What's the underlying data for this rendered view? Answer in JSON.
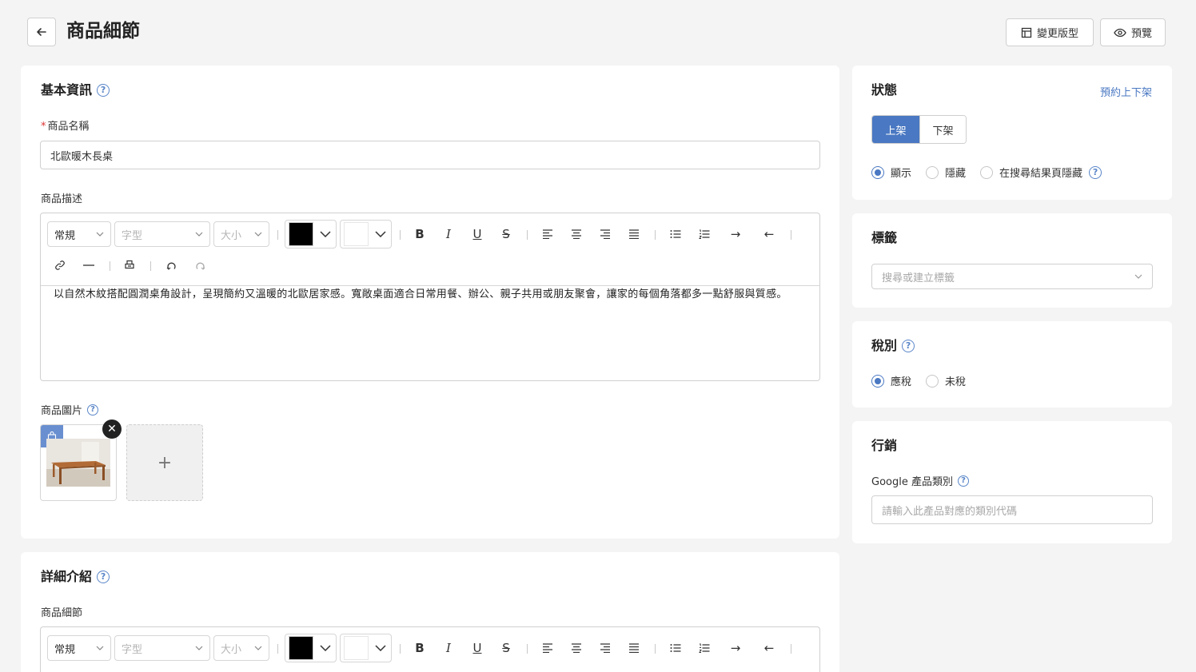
{
  "header": {
    "title": "商品細節",
    "layout_label": "變更版型",
    "preview_label": "預覽"
  },
  "basic": {
    "title": "基本資訊",
    "name_label": "商品名稱",
    "name_value": "北歐暖木長桌",
    "desc_label": "商品描述",
    "desc_text": "以自然木紋搭配圓潤桌角設計，呈現簡約又溫暖的北歐居家感。寬敞桌面適合日常用餐、辦公、親子共用或朋友聚會，讓家的每個角落都多一點舒服與質感。",
    "images_label": "商品圖片"
  },
  "editor_toolbar": {
    "format": "常規",
    "font": "字型",
    "size": "大小",
    "text_color": "#000000",
    "bg_color": "#ffffff"
  },
  "detail": {
    "title": "詳細介紹",
    "content_label": "商品細節"
  },
  "status": {
    "title": "狀態",
    "schedule_link": "預約上下架",
    "on_label": "上架",
    "off_label": "下架",
    "visibility": [
      "顯示",
      "隱藏",
      "在搜尋結果頁隱藏"
    ],
    "visibility_selected": "顯示"
  },
  "tags": {
    "title": "標籤",
    "placeholder": "搜尋或建立標籤"
  },
  "tax": {
    "title": "稅別",
    "options": [
      "應稅",
      "未稅"
    ],
    "selected": "應稅"
  },
  "marketing": {
    "title": "行銷",
    "google_label": "Google 產品類別",
    "google_placeholder": "請輸入此產品對應的類別代碼"
  },
  "colors": {
    "accent": "#4a78c2",
    "background": "#f4f4f5"
  }
}
